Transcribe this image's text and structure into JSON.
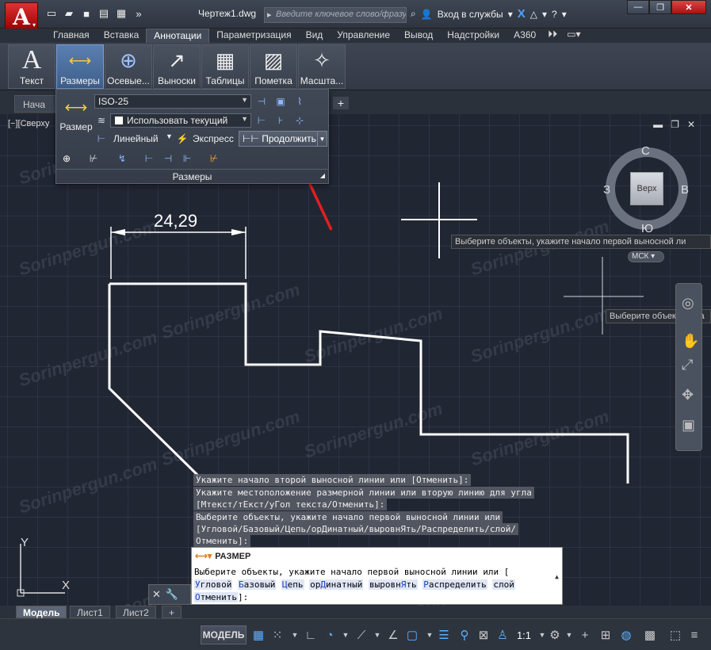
{
  "app": {
    "logo_letter": "A",
    "document_title": "Чертеж1.dwg",
    "search_placeholder": "Введите ключевое слово/фразу",
    "sign_in": "Вход в службы"
  },
  "ribbon_tabs": [
    "Главная",
    "Вставка",
    "Аннотации",
    "Параметризация",
    "Вид",
    "Управление",
    "Вывод",
    "Надстройки",
    "A360"
  ],
  "ribbon_active_tab": "Аннотации",
  "ribbon_buttons": [
    {
      "label": "Текст",
      "icon": "text-icon"
    },
    {
      "label": "Размеры",
      "icon": "dimension-icon"
    },
    {
      "label": "Осевые...",
      "icon": "centerline-icon"
    },
    {
      "label": "Выноски",
      "icon": "leader-icon"
    },
    {
      "label": "Таблицы",
      "icon": "table-icon"
    },
    {
      "label": "Пометка",
      "icon": "markup-icon"
    },
    {
      "label": "Масшта...",
      "icon": "scale-icon"
    }
  ],
  "file_tab": "Нача",
  "viewport_label": "[−][Сверху",
  "dim_panel": {
    "big_button": "Размер",
    "style": "ISO-25",
    "layer": "Использовать текущий",
    "linear": "Линейный",
    "express": "Экспресс",
    "continue": "Продолжить",
    "footer": "Размеры"
  },
  "drawing": {
    "dimension_value": "24,29"
  },
  "viewcube": {
    "top": "Верх",
    "north": "С",
    "south": "Ю",
    "east": "В",
    "west": "З",
    "wcs": "МСК"
  },
  "tooltips": {
    "tip1": "Выберите объекты, укажите начало первой выносной ли",
    "tip2": "Выберите объекты, ука"
  },
  "command_history": [
    "Укажите начало второй выносной линии или [Отменить]:",
    "Укажите местоположение размерной линии или вторую линию для угла",
    "[Мтекст/тЕкст/уГол текста/Отменить]:",
    "Выберите объекты, укажите начало первой выносной линии или",
    "[Угловой/Базовый/Цепь/орДинатный/выровнЯть/Распределить/слой/",
    "Отменить]:"
  ],
  "command_line": {
    "command": "РАЗМЕР",
    "prompt": "Выберите объекты, укажите начало первой выносной линии или [",
    "options": [
      {
        "pre": "",
        "key": "У",
        "post": "гловой"
      },
      {
        "pre": "",
        "key": "Б",
        "post": "азовый"
      },
      {
        "pre": "",
        "key": "Ц",
        "post": "епь"
      },
      {
        "pre": "ор",
        "key": "Д",
        "post": "инатный"
      },
      {
        "pre": "выровн",
        "key": "Я",
        "post": "ть"
      },
      {
        "pre": "",
        "key": "Р",
        "post": "аспределить"
      },
      {
        "pre": "",
        "key": "",
        "post": "слой"
      }
    ],
    "last_option": {
      "pre": "",
      "key": "О",
      "post": "тменить"
    },
    "end": "]:"
  },
  "ucs": {
    "x": "X",
    "y": "Y"
  },
  "layout_tabs": [
    "Модель",
    "Лист1",
    "Лист2"
  ],
  "status": {
    "model": "МОДЕЛЬ",
    "scale": "1:1"
  },
  "watermark": "Sorinpergun.com",
  "colors": {
    "accent": "#4a90d9",
    "arrow": "#e02020",
    "geometry": "#ffffff"
  }
}
